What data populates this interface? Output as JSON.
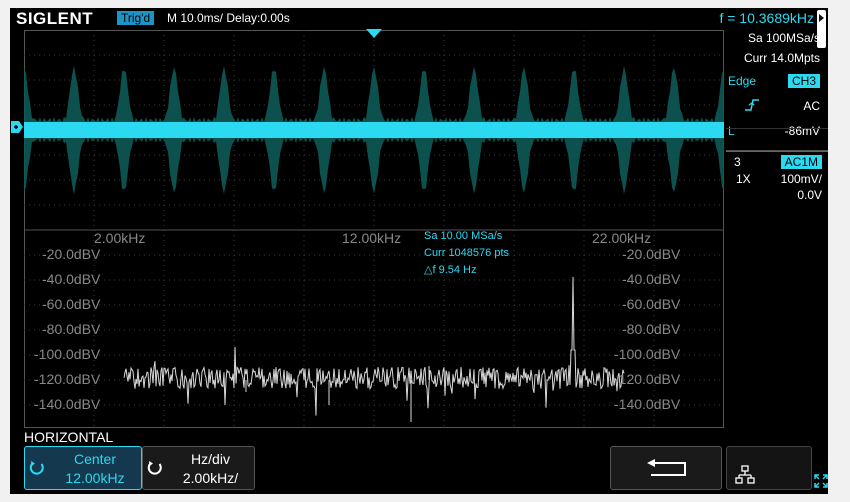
{
  "topbar": {
    "logo": "SIGLENT",
    "trig_status": "Trig'd",
    "timebase": "M 10.0ms/ Delay:0.00s",
    "frequency": "f = 10.3689kHz"
  },
  "acquisition": {
    "sample_rate": "Sa 100MSa/s",
    "memory": "Curr 14.0Mpts"
  },
  "trigger": {
    "type": "Edge",
    "source": "CH3",
    "slope_icon": "rising-edge-icon",
    "coupling": "AC",
    "level_label": "L",
    "level": "-86mV"
  },
  "channel": {
    "number": "3",
    "coupling": "AC1M",
    "probe": "1X",
    "scale": "100mV/",
    "offset": "0.0V"
  },
  "fft": {
    "sample_rate": "Sa 10.00 MSa/s",
    "points": "Curr 1048576 pts",
    "delta_f": "△f 9.54 Hz",
    "freq_labels": [
      "2.00kHz",
      "12.00kHz",
      "22.00kHz"
    ],
    "db_labels": [
      "-20.0dBV",
      "-40.0dBV",
      "-60.0dBV",
      "-80.0dBV",
      "-100.0dBV",
      "-120.0dBV",
      "-140.0dBV"
    ],
    "db_labels_right": [
      "-20.0dBV",
      "-40.0dBV",
      "-60.0dBV",
      "-80.0dBV",
      "-100.0dBV",
      "-120.0dBV",
      "-140.0dBV"
    ]
  },
  "menu": {
    "title": "HORIZONTAL",
    "center_label": "Center",
    "center_value": "12.00kHz",
    "hzdiv_label": "Hz/div",
    "hzdiv_value": "2.00kHz/"
  },
  "colors": {
    "channel": "#2bd9f0",
    "spectrum": "#d8d8d8",
    "grid": "#3a3a3a",
    "accent": "#1d94c6"
  }
}
